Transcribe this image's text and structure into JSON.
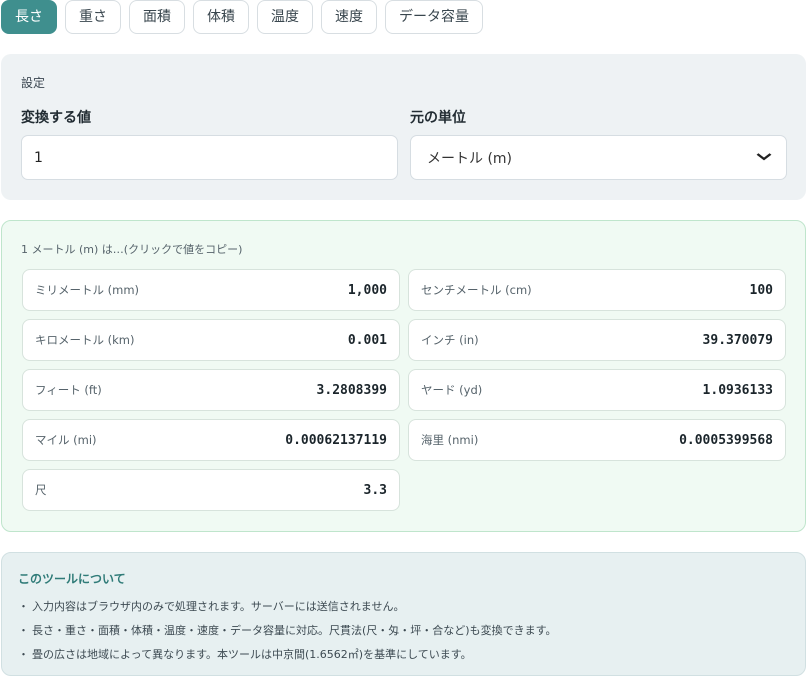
{
  "tabs": [
    {
      "label": "長さ",
      "active": true
    },
    {
      "label": "重さ",
      "active": false
    },
    {
      "label": "面積",
      "active": false
    },
    {
      "label": "体積",
      "active": false
    },
    {
      "label": "温度",
      "active": false
    },
    {
      "label": "速度",
      "active": false
    },
    {
      "label": "データ容量",
      "active": false
    }
  ],
  "settings": {
    "title": "設定",
    "value_label": "変換する値",
    "value": "1",
    "unit_label": "元の単位",
    "unit_selected": "メートル (m)"
  },
  "results": {
    "caption": "1 メートル (m) は…(クリックで値をコピー)",
    "items": [
      {
        "name": "ミリメートル (mm)",
        "value": "1,000"
      },
      {
        "name": "センチメートル (cm)",
        "value": "100"
      },
      {
        "name": "キロメートル (km)",
        "value": "0.001"
      },
      {
        "name": "インチ (in)",
        "value": "39.370079"
      },
      {
        "name": "フィート (ft)",
        "value": "3.2808399"
      },
      {
        "name": "ヤード (yd)",
        "value": "1.0936133"
      },
      {
        "name": "マイル (mi)",
        "value": "0.00062137119"
      },
      {
        "name": "海里 (nmi)",
        "value": "0.0005399568"
      },
      {
        "name": "尺",
        "value": "3.3"
      }
    ]
  },
  "about": {
    "title": "このツールについて",
    "bullet": "・",
    "notes": [
      "入力内容はブラウザ内のみで処理されます。サーバーには送信されません。",
      "長さ・重さ・面積・体積・温度・速度・データ容量に対応。尺貫法(尺・匁・坪・合など)も変換できます。",
      "畳の広さは地域によって異なります。本ツールは中京間(1.6562㎡)を基準にしています。"
    ]
  },
  "colors": {
    "accent": "#3f8f8e",
    "results_bg": "#f0faf3",
    "results_border": "#bfe5cc",
    "settings_bg": "#eef2f4",
    "about_bg": "#e7f0f1"
  },
  "icons": {
    "select_arrow": "chevron-down-icon"
  }
}
